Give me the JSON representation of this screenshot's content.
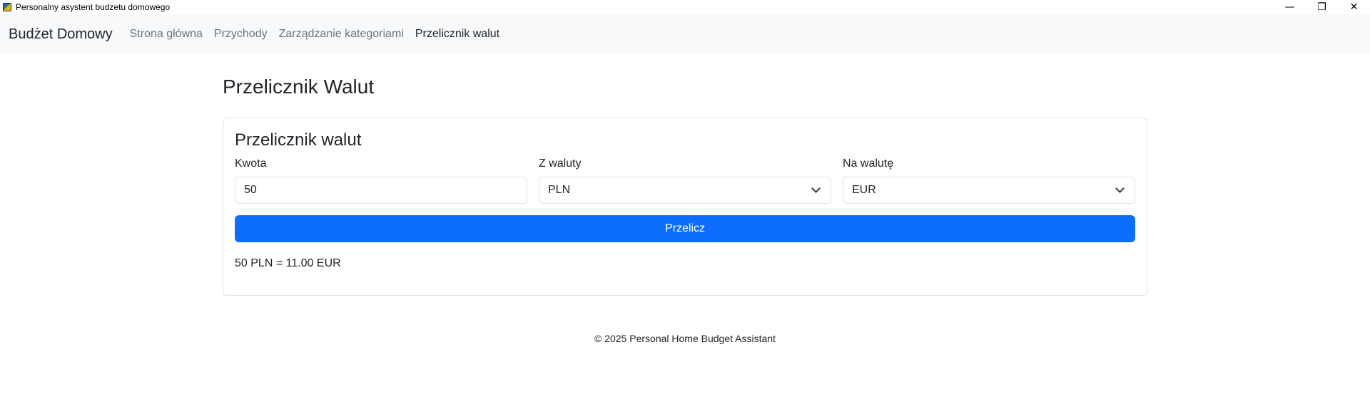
{
  "window": {
    "title": "Personalny asystent budzetu domowego",
    "controls": {
      "minimize": "—",
      "restore": "❐",
      "close": "✕"
    }
  },
  "navbar": {
    "brand": "Budżet Domowy",
    "links": [
      {
        "label": "Strona główna",
        "active": false
      },
      {
        "label": "Przychody",
        "active": false
      },
      {
        "label": "Zarządzanie kategoriami",
        "active": false
      },
      {
        "label": "Przelicznik walut",
        "active": true
      }
    ]
  },
  "page": {
    "title": "Przelicznik Walut"
  },
  "converter": {
    "card_title": "Przelicznik walut",
    "amount_label": "Kwota",
    "amount_value": "50",
    "from_label": "Z waluty",
    "from_value": "PLN",
    "to_label": "Na walutę",
    "to_value": "EUR",
    "button_label": "Przelicz",
    "result": "50 PLN = 11.00 EUR"
  },
  "footer": {
    "text": "© 2025 Personal Home Budget Assistant"
  },
  "colors": {
    "primary": "#0d6efd",
    "navbar_bg": "#f8f9fa",
    "muted_link": "#6c757d"
  }
}
